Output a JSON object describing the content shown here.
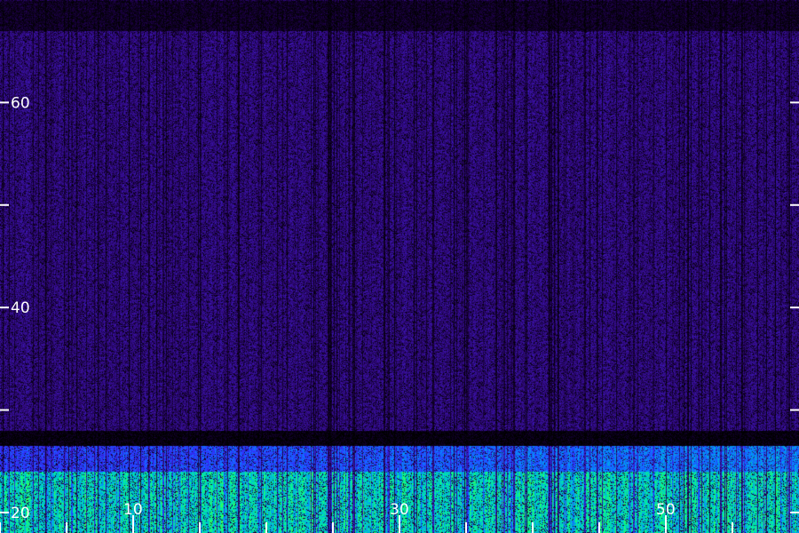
{
  "chart_data": {
    "type": "heatmap",
    "title": "",
    "xlabel": "",
    "ylabel": "",
    "xlim": [
      0,
      60
    ],
    "ylim": [
      18,
      70
    ],
    "x_ticks": [
      {
        "value": 10,
        "label": "10"
      },
      {
        "value": 30,
        "label": "30"
      },
      {
        "value": 50,
        "label": "50"
      }
    ],
    "x_minor_ticks": [
      0,
      5,
      15,
      20,
      25,
      35,
      40,
      45,
      55
    ],
    "y_ticks": [
      {
        "value": 20,
        "label": "20"
      },
      {
        "value": 30,
        "label": ""
      },
      {
        "value": 40,
        "label": "40"
      },
      {
        "value": 50,
        "label": ""
      },
      {
        "value": 60,
        "label": ""
      },
      {
        "value": 60,
        "label": "60"
      }
    ],
    "y_tick_values": [
      20,
      30,
      40,
      50,
      60
    ],
    "y_tick_labels": {
      "20": "20",
      "40": "40",
      "60": "60"
    },
    "colormap": [
      "#000000",
      "#1a0040",
      "#3a10a0",
      "#3030ff",
      "#0090ff",
      "#00ff90",
      "#80ff00"
    ],
    "bands": [
      {
        "from": 18,
        "to": 24,
        "intensity": 0.85
      },
      {
        "from": 24,
        "to": 26.5,
        "intensity": 0.55
      },
      {
        "from": 26.5,
        "to": 28,
        "intensity": 0.05
      },
      {
        "from": 28,
        "to": 67,
        "intensity": 0.3
      },
      {
        "from": 67,
        "to": 70,
        "intensity": 0.12
      }
    ],
    "grid": false,
    "legend": "none"
  }
}
